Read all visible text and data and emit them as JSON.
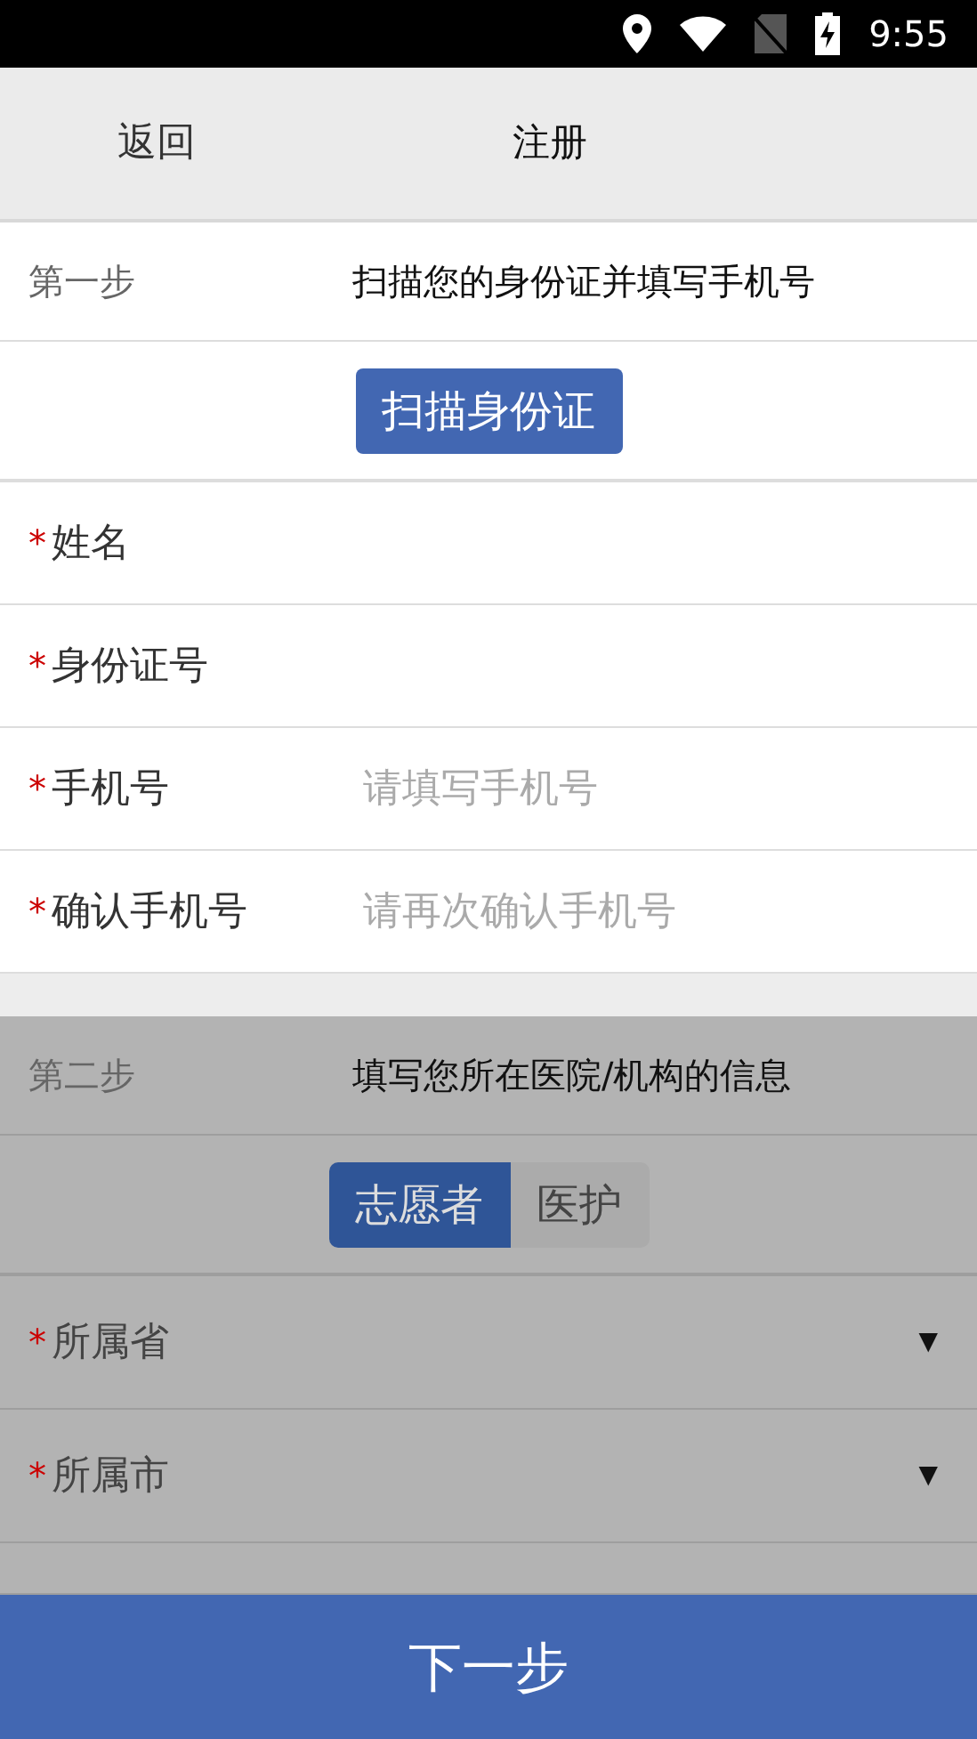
{
  "status_bar": {
    "time": "9:55"
  },
  "header": {
    "back": "返回",
    "title": "注册"
  },
  "steps": [
    {
      "label": "第一步",
      "description": "扫描您的身份证并填写手机号",
      "disabled": false,
      "action": {
        "kind": "button",
        "label": "扫描身份证"
      },
      "fields": [
        {
          "kind": "text",
          "label": "姓名",
          "required_mark": "*"
        },
        {
          "kind": "text",
          "label": "身份证号",
          "required_mark": "*"
        },
        {
          "kind": "text",
          "label": "手机号",
          "required_mark": "*",
          "placeholder": "请填写手机号"
        },
        {
          "kind": "text",
          "label": "确认手机号",
          "required_mark": "*",
          "placeholder": "请再次确认手机号"
        }
      ]
    },
    {
      "label": "第二步",
      "description": "填写您所在医院/机构的信息",
      "disabled": true,
      "action": {
        "kind": "segmented",
        "options": [
          {
            "label": "志愿者",
            "selected": true
          },
          {
            "label": "医护",
            "selected": false
          }
        ]
      },
      "fields": [
        {
          "kind": "select",
          "label": "所属省",
          "required_mark": "*",
          "arrow": "▼"
        },
        {
          "kind": "select",
          "label": "所属市",
          "required_mark": "*",
          "arrow": "▼"
        },
        {
          "kind": "blank"
        }
      ]
    }
  ],
  "next_button": "下一步"
}
